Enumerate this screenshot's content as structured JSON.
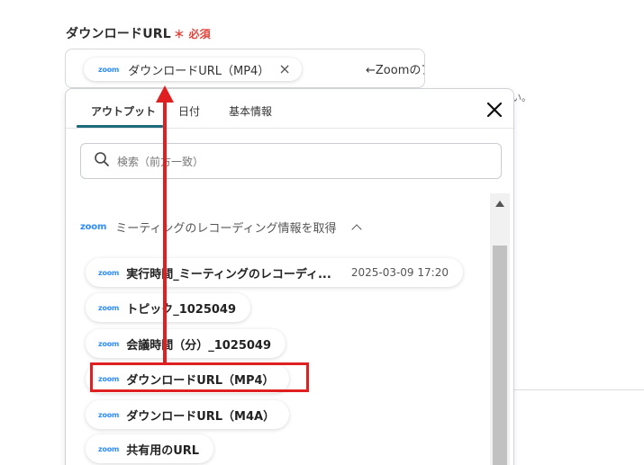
{
  "field": {
    "label": "ダウンロードURL",
    "required_mark": "＊",
    "required_text": "必須",
    "chip_label": "ダウンロードURL（MP4）",
    "chip_remove": "×",
    "note": "←Zoomのアウトプット",
    "zoom_logo": "zoom"
  },
  "background": {
    "hint": "い。"
  },
  "panel": {
    "tabs": [
      {
        "label": "アウトプット",
        "active": true
      },
      {
        "label": "日付",
        "active": false
      },
      {
        "label": "基本情報",
        "active": false
      }
    ],
    "close_icon": "close-icon",
    "search": {
      "placeholder": "検索（前方一致）",
      "icon": "search-icon"
    },
    "group": {
      "logo": "zoom",
      "title": "ミーティングのレコーディング情報を取得"
    },
    "items": [
      {
        "logo": "zoom",
        "label": "実行時間_ミーティングのレコーディ...",
        "meta": "2025-03-09 17:20"
      },
      {
        "logo": "zoom",
        "label": "トピック_1025049",
        "meta": ""
      },
      {
        "logo": "zoom",
        "label": "会議時間（分）_1025049",
        "meta": ""
      },
      {
        "logo": "zoom",
        "label": "ダウンロードURL（MP4）",
        "meta": ""
      },
      {
        "logo": "zoom",
        "label": "ダウンロードURL（M4A）",
        "meta": ""
      },
      {
        "logo": "zoom",
        "label": "共有用のURL",
        "meta": ""
      }
    ]
  },
  "colors": {
    "accent": "#1d6b7a",
    "zoom_blue": "#2d8cff",
    "annotation_red": "#e02020",
    "required_red": "#e6433a"
  }
}
